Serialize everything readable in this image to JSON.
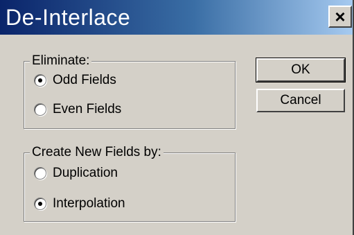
{
  "window": {
    "title": "De-Interlace",
    "close_glyph": "✕"
  },
  "eliminate": {
    "label": "Eliminate:",
    "options": [
      {
        "label": "Odd Fields",
        "selected": true
      },
      {
        "label": "Even Fields",
        "selected": false
      }
    ]
  },
  "create": {
    "label": "Create New Fields by:",
    "options": [
      {
        "label": "Duplication",
        "selected": false
      },
      {
        "label": "Interpolation",
        "selected": true
      }
    ]
  },
  "buttons": {
    "ok": "OK",
    "cancel": "Cancel"
  },
  "colors": {
    "title_gradient_start": "#0a246a",
    "title_gradient_end": "#a6caf0",
    "dialog_bg": "#d4d0c8"
  }
}
